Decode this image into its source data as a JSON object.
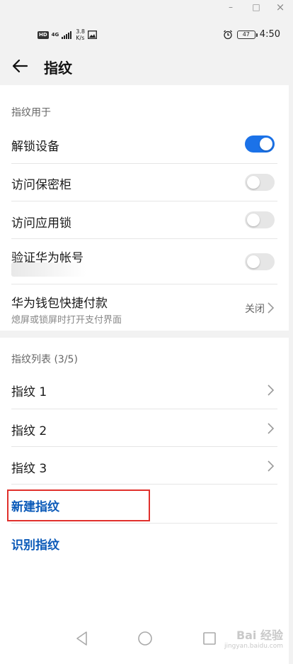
{
  "window_controls": {
    "minimize": "–",
    "maximize": "□",
    "close": "×"
  },
  "status_bar": {
    "hd": "HD",
    "network": "4G",
    "speed_value": "3.8",
    "speed_unit": "K/s",
    "battery": "47",
    "time": "4:50"
  },
  "header": {
    "title": "指纹"
  },
  "usage_section": {
    "header": "指纹用于",
    "items": [
      {
        "label": "解锁设备",
        "toggle": "on"
      },
      {
        "label": "访问保密柜",
        "toggle": "off"
      },
      {
        "label": "访问应用锁",
        "toggle": "off"
      },
      {
        "label": "验证华为帐号",
        "toggle": "off"
      }
    ],
    "wallet": {
      "label": "华为钱包快捷付款",
      "sublabel": "熄屏或锁屏时打开支付界面",
      "value": "关闭"
    }
  },
  "list_section": {
    "header": "指纹列表 (3/5)",
    "items": [
      {
        "label": "指纹 1"
      },
      {
        "label": "指纹 2"
      },
      {
        "label": "指纹 3"
      }
    ],
    "new_fingerprint": "新建指纹",
    "identify_fingerprint": "识别指纹"
  },
  "watermark": {
    "main": "Bai 经验",
    "sub": "jingyan.baidu.com"
  },
  "colors": {
    "accent": "#1b72e8",
    "link": "#0a59b8",
    "highlight": "#e0302c"
  }
}
